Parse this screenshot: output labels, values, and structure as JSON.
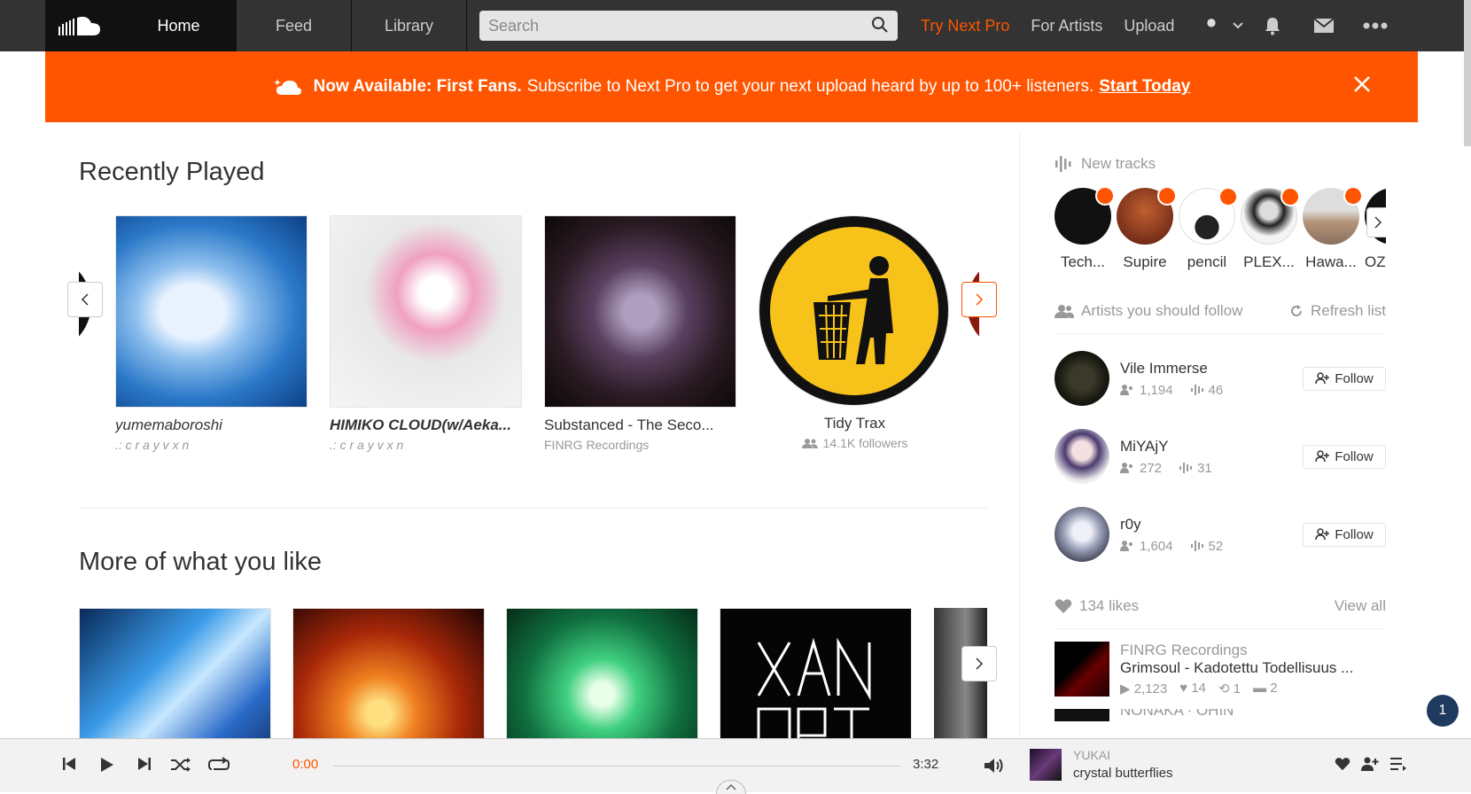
{
  "header": {
    "tabs": [
      {
        "label": "Home",
        "active": true
      },
      {
        "label": "Feed",
        "active": false
      },
      {
        "label": "Library",
        "active": false
      }
    ],
    "search_placeholder": "Search",
    "try_next_pro": "Try Next Pro",
    "for_artists": "For Artists",
    "upload": "Upload"
  },
  "banner": {
    "headline": "Now Available: First Fans.",
    "text": "Subscribe to Next Pro to get your next upload heard by up to 100+ listeners.",
    "cta": "Start Today"
  },
  "recently_played": {
    "title": "Recently Played",
    "items": [
      {
        "title": "yumemaboroshi",
        "subtitle": ".: c r a y v x n"
      },
      {
        "title": "HIMIKO CLOUD(w/Aeka...",
        "subtitle": ".: c r a y v x n"
      },
      {
        "title": "Substanced - The Seco...",
        "subtitle": "FINRG Recordings"
      },
      {
        "title": "Tidy Trax",
        "subtitle": "14.1K followers"
      }
    ]
  },
  "more_like": {
    "title": "More of what you like"
  },
  "sidebar": {
    "new_tracks_label": "New tracks",
    "new_tracks": [
      {
        "label": "Tech..."
      },
      {
        "label": "Supire"
      },
      {
        "label": "pencil"
      },
      {
        "label": "PLEX..."
      },
      {
        "label": "Hawa..."
      },
      {
        "label": "OZ"
      }
    ],
    "follow_label": "Artists you should follow",
    "refresh_label": "Refresh list",
    "follow_button": "Follow",
    "artists": [
      {
        "name": "Vile Immerse",
        "followers": "1,194",
        "tracks": "46"
      },
      {
        "name": "MiYAjY",
        "followers": "272",
        "tracks": "31"
      },
      {
        "name": "r0y",
        "followers": "1,604",
        "tracks": "52"
      }
    ],
    "likes_label": "134 likes",
    "view_all": "View all",
    "liked": [
      {
        "user": "FINRG Recordings",
        "title": "Grimsoul - Kadotettu Todellisuus ...",
        "plays": "2,123",
        "likes": "14",
        "reposts": "1",
        "comments": "2"
      },
      {
        "user": "NONAKA · OHIN"
      }
    ]
  },
  "player": {
    "current_time": "0:00",
    "duration": "3:32",
    "artist": "YUKAI",
    "title": "crystal butterflies",
    "progress": 0
  },
  "notifications_count": "1",
  "colors": {
    "accent": "#ff5500",
    "header_bg": "#333333"
  }
}
